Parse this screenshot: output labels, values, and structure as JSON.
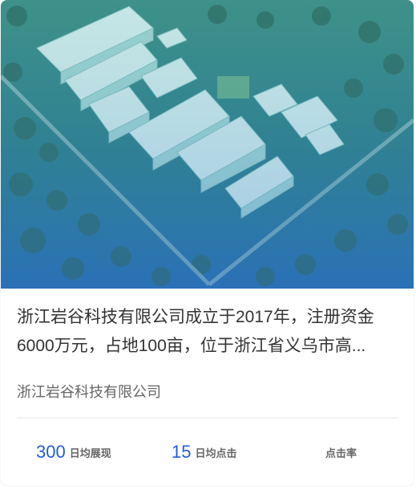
{
  "card": {
    "image_alt": "aerial-factory-park",
    "description": "浙江岩谷科技有限公司成立于2017年，注册资金6000万元，占地100亩，位于浙江省义乌市高...",
    "company": "浙江岩谷科技有限公司"
  },
  "stats": [
    {
      "value": "300",
      "label": "日均展现"
    },
    {
      "value": "15",
      "label": "日均点击"
    },
    {
      "value": "",
      "label": "点击率"
    }
  ],
  "colors": {
    "accent": "#1f5de0",
    "text": "#333333",
    "subtext": "#666666",
    "overlay": "#2a8a9a"
  }
}
